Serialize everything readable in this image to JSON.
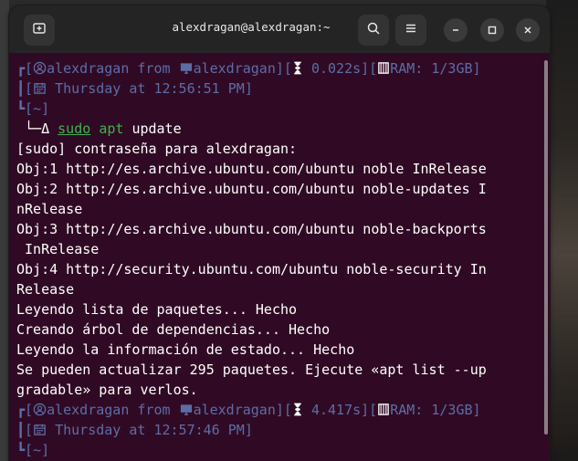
{
  "window": {
    "title": "alexdragan@alexdragan:~",
    "buttons": {
      "new_tab": "new-tab-icon",
      "search": "search-icon",
      "menu": "menu-icon",
      "minimize": "minimize-icon",
      "maximize": "maximize-icon",
      "close": "close-icon"
    }
  },
  "colors": {
    "background": "#300a24",
    "prompt": "#5c6da6",
    "command_green": "#3fb34f",
    "text": "#ffffff",
    "titlebar": "#242424"
  },
  "terminal": {
    "prompt1": {
      "user": "alexdragan",
      "from": "from",
      "host": "alexdragan",
      "time": "0.022s",
      "ram": "RAM: 1/3GB",
      "date": "Thursday at 12:56:51 PM",
      "cwd": "~"
    },
    "command": {
      "symbol": "Δ",
      "sudo": "sudo",
      "apt": "apt",
      "args": "update"
    },
    "output": [
      "[sudo] contraseña para alexdragan:",
      "Obj:1 http://es.archive.ubuntu.com/ubuntu noble InRelease",
      "Obj:2 http://es.archive.ubuntu.com/ubuntu noble-updates I",
      "nRelease",
      "Obj:3 http://es.archive.ubuntu.com/ubuntu noble-backports",
      " InRelease",
      "Obj:4 http://security.ubuntu.com/ubuntu noble-security In",
      "Release",
      "Leyendo lista de paquetes... Hecho",
      "Creando árbol de dependencias... Hecho",
      "Leyendo la información de estado... Hecho",
      "Se pueden actualizar 295 paquetes. Ejecute «apt list --up",
      "gradable» para verlos."
    ],
    "prompt2": {
      "user": "alexdragan",
      "from": "from",
      "host": "alexdragan",
      "time": "4.417s",
      "ram": "RAM: 1/3GB",
      "date": "Thursday at 12:57:46 PM",
      "cwd": "~"
    }
  }
}
